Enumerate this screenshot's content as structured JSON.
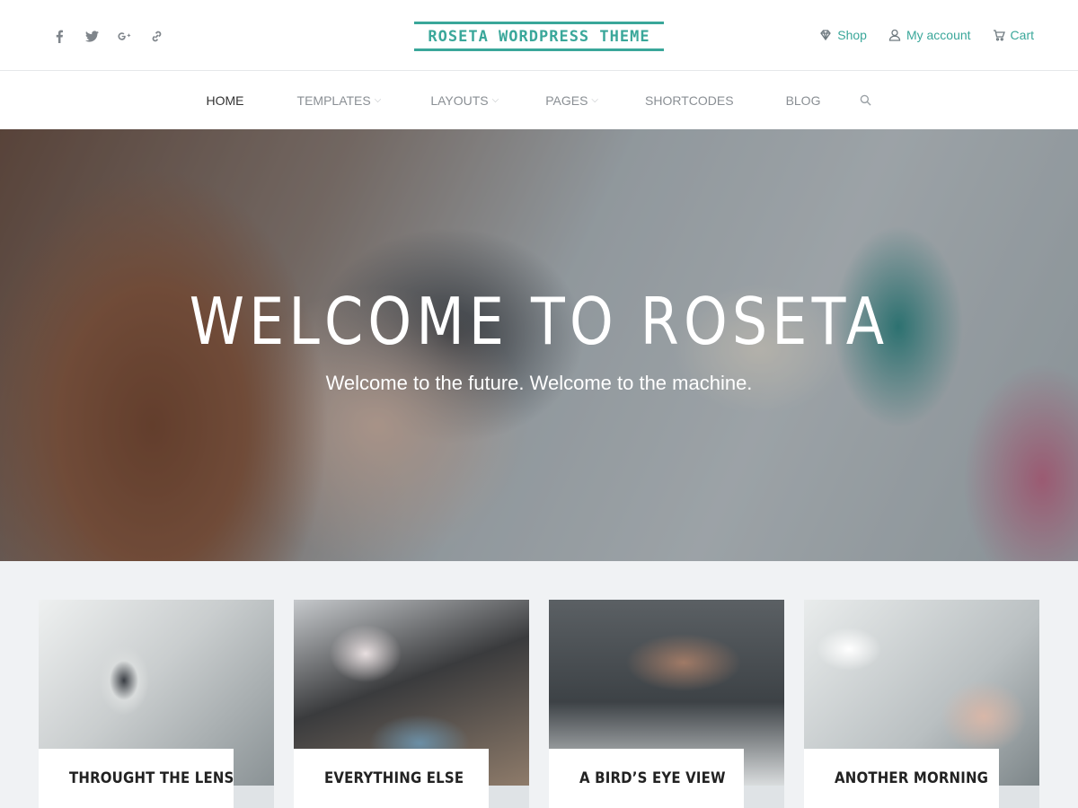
{
  "header": {
    "logo_text": "ROSETA WORDPRESS THEME",
    "social": [
      "facebook-icon",
      "twitter-icon",
      "google-plus-icon",
      "link-icon"
    ],
    "user_nav": {
      "shop": "Shop",
      "account": "My account",
      "cart": "Cart"
    }
  },
  "nav": {
    "items": [
      {
        "label": "HOME",
        "active": true,
        "dropdown": false
      },
      {
        "label": "TEMPLATES",
        "active": false,
        "dropdown": true
      },
      {
        "label": "LAYOUTS",
        "active": false,
        "dropdown": true
      },
      {
        "label": "PAGES",
        "active": false,
        "dropdown": true
      },
      {
        "label": "SHORTCODES",
        "active": false,
        "dropdown": false
      },
      {
        "label": "BLOG",
        "active": false,
        "dropdown": false
      }
    ]
  },
  "hero": {
    "title": "WELCOME TO ROSETA",
    "subtitle": "Welcome to the future. Welcome to the machine."
  },
  "cards": [
    {
      "title": "THROUGHT THE LENS"
    },
    {
      "title": "EVERYTHING ELSE"
    },
    {
      "title": "A BIRD’S EYE VIEW"
    },
    {
      "title": "ANOTHER MORNING"
    }
  ],
  "colors": {
    "accent": "#3aa79a",
    "nav_text": "#8a8f94",
    "cards_bg": "#f0f2f4"
  }
}
